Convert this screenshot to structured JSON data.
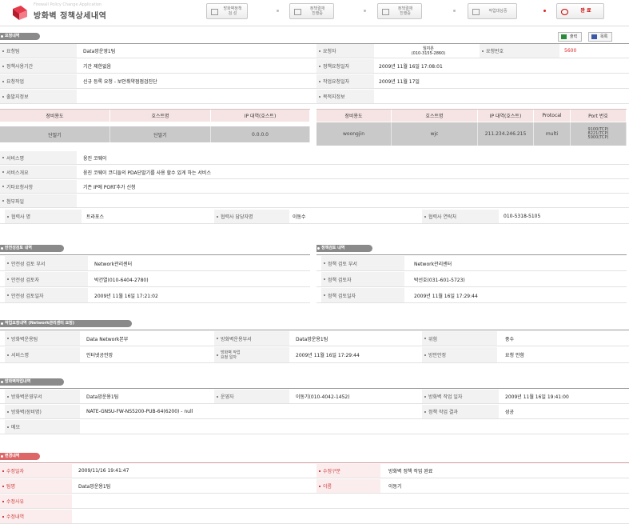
{
  "header": {
    "logo_sub": "Firewall Policy Change Application",
    "title": "방화벽 정책상세내역",
    "nav": [
      {
        "label": "방화벽정책\n검 성"
      },
      {
        "label": "정책결재\n진행중"
      },
      {
        "label": "정책결재\n진행중"
      },
      {
        "label": "작업대상중"
      },
      {
        "label": "완 료"
      }
    ]
  },
  "request_section": {
    "title": "요청내역",
    "print_button": "출력",
    "list_button": "목록",
    "rows": [
      {
        "label": "요청팀",
        "value": "Data망운영1팀",
        "label2": "요청자",
        "value2": "임지은\n(010-3155-2860)",
        "label3": "요청번호",
        "value3": "5600"
      },
      {
        "label": "정책사용기간",
        "value": "기간 제한없음",
        "label2": "정책요청일자",
        "value2": "2009년 11월 16일 17:08:01"
      },
      {
        "label": "요청작업",
        "value": "신규 등록 요청 - 보안취약점점검진단",
        "label2": "작업요청일자",
        "value2": "2009년 11월 17일"
      },
      {
        "label": "출발지정보",
        "value": "",
        "label2": "목적지정보",
        "value2": ""
      }
    ],
    "source_table": {
      "headers": [
        "장비용도",
        "호스트명",
        "IP 대역(호스트)"
      ],
      "rows": [
        [
          "단말기",
          "단말기",
          "0.0.0.0"
        ]
      ]
    },
    "dest_table": {
      "headers": [
        "장비용도",
        "호스트명",
        "IP 대역(호스트)",
        "Protocal",
        "Port 번호"
      ],
      "rows": [
        [
          "woongjin",
          "wjc",
          "211.234.246.215",
          "multi",
          "9100(TCP)\n8221(TCP)\n5900(TCP)"
        ]
      ]
    },
    "service_rows": [
      {
        "label": "서비스명",
        "value": "웅진 코웨이"
      },
      {
        "label": "서비스개요",
        "value": "웅진 코웨이 코디들의 PDA단말기를 사용 할수 있게 하는 서비스"
      },
      {
        "label": "기타요청사항",
        "value": "기존 IP에 PORT추가 신청"
      },
      {
        "label": "첨부파일",
        "value": ""
      }
    ],
    "partner_row": {
      "label1": "협력사 명",
      "value1": "트라포스",
      "label2": "협력사 담당자명",
      "value2": "이동수",
      "label3": "협력사 연락처",
      "value3": "010-5318-5105"
    }
  },
  "security_review": {
    "title": "안전성검토 내역",
    "rows": [
      {
        "label": "안전성 검토 부서",
        "value": "Network관리센터"
      },
      {
        "label": "안전성 검토자",
        "value": "박건열(010-6404-2780)"
      },
      {
        "label": "안전성 검토일자",
        "value": "2009년 11월 16일 17:21:02"
      }
    ]
  },
  "policy_review": {
    "title": "정책검토 내역",
    "rows": [
      {
        "label": "정책 검토 부서",
        "value": "Network관리센터"
      },
      {
        "label": "정책 검토자",
        "value": "박선호(031-601-5723)"
      },
      {
        "label": "정책 검토일자",
        "value": "2009년 11월 16일 17:29:44"
      }
    ]
  },
  "work_request": {
    "title": "작업요청내역 (Network관리센터 요청)",
    "rows": [
      {
        "label1": "방화벽운용팀",
        "value1": "Data Network본부",
        "label2": "방화벽운용부서",
        "value2": "Data망운용1팀",
        "label3": "위험",
        "value3": "중수"
      },
      {
        "label1": "서비스명",
        "value1": "인터넷공인망",
        "label2": "방화벽 작업\n요청 일자",
        "value2": "2009년 11월 16일 17:29:44",
        "label3": "방안안정",
        "value3": "요청 안함"
      }
    ]
  },
  "work_result": {
    "title": "방화벽작업내역",
    "rows": [
      {
        "label1": "방화벽운영부서",
        "value1": "Data망운용1팀",
        "label2": "운영자",
        "value2": "이동기(010-4042-1452)",
        "label3": "방화벽 작업 일자",
        "value3": "2009년 11월 16일 19:41:00"
      },
      {
        "label1": "방화벽(장비명)",
        "value1": "NATE-GNSU-FW-NS5200-PUB-64(6200) - null",
        "label3": "정책 작업 결과",
        "value3": "성공"
      },
      {
        "label1": "메모",
        "value1": ""
      }
    ]
  },
  "change_history": {
    "title": "변경내역",
    "rows": [
      {
        "label1": "수정일자",
        "value1": "2009/11/16 19:41:47",
        "label2": "수정구분",
        "value2": "방화벽 정책 작업 완료"
      },
      {
        "label1": "팀명",
        "value1": "Data망운용1팀",
        "label2": "이름",
        "value2": "이동기"
      },
      {
        "label1": "수정사유",
        "value1": ""
      },
      {
        "label1": "수정내역",
        "value1": ""
      }
    ]
  },
  "colors": {
    "accent": "#e02020",
    "section_gray": "#8a8a8a",
    "section_red": "#d66666",
    "pink_header": "#f6e4e4"
  },
  "icons": [
    "logo-icon",
    "document-icon",
    "print-icon",
    "list-icon",
    "check-icon"
  ]
}
